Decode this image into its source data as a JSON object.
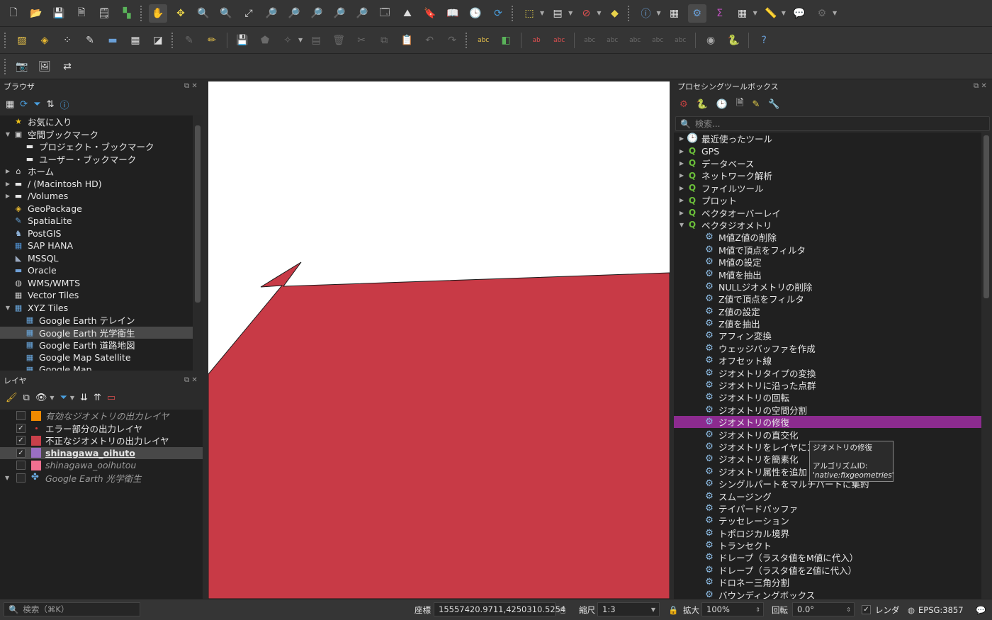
{
  "toolbar1": {
    "icons": [
      "new-project",
      "open-project",
      "save-project",
      "save-as",
      "layout-manager",
      "style-manager",
      "pan",
      "pan-to-selection",
      "zoom-in",
      "zoom-out",
      "zoom-full",
      "zoom-to-selection",
      "zoom-to-layer",
      "zoom-native",
      "zoom-last",
      "zoom-next",
      "new-map-view",
      "new-3d-view",
      "new-bookmark",
      "show-bookmarks",
      "temporal-controller",
      "refresh",
      "select-features",
      "deselect",
      "select-by-location",
      "identify",
      "attribute-table",
      "processing-toolbox",
      "statistics",
      "field-calculator",
      "measure",
      "map-tips",
      "plugins"
    ]
  },
  "toolbar2": {
    "icons": [
      "open-data-source",
      "new-geopackage",
      "digitize",
      "edit-pencil",
      "add-polygon",
      "vertex-tool",
      "undo",
      "redo",
      "label-abc",
      "pin-label",
      "highlight-label",
      "python-console",
      "help"
    ]
  },
  "browser": {
    "title": "ブラウザ",
    "items": [
      {
        "label": "お気に入り",
        "indent": 0,
        "arrow": "",
        "icon": "★",
        "icon_color": "#f0c419"
      },
      {
        "label": "空間ブックマーク",
        "indent": 0,
        "arrow": "▼",
        "icon": "▣",
        "icon_color": "#cfcfcf"
      },
      {
        "label": "プロジェクト・ブックマーク",
        "indent": 1,
        "arrow": "",
        "icon": "▬",
        "icon_color": "#e6e6e6"
      },
      {
        "label": "ユーザー・ブックマーク",
        "indent": 1,
        "arrow": "",
        "icon": "▬",
        "icon_color": "#e6e6e6"
      },
      {
        "label": "ホーム",
        "indent": 0,
        "arrow": "▶",
        "icon": "⌂",
        "icon_color": "#e6e6e6"
      },
      {
        "label": "/ (Macintosh HD)",
        "indent": 0,
        "arrow": "▶",
        "icon": "▬",
        "icon_color": "#e6e6e6"
      },
      {
        "label": "/Volumes",
        "indent": 0,
        "arrow": "▶",
        "icon": "▬",
        "icon_color": "#e6e6e6"
      },
      {
        "label": "GeoPackage",
        "indent": 0,
        "arrow": "",
        "icon": "◈",
        "icon_color": "#e8b830"
      },
      {
        "label": "SpatiaLite",
        "indent": 0,
        "arrow": "",
        "icon": "✎",
        "icon_color": "#6aa9e0"
      },
      {
        "label": "PostGIS",
        "indent": 0,
        "arrow": "",
        "icon": "♞",
        "icon_color": "#8fb3d9"
      },
      {
        "label": "SAP HANA",
        "indent": 0,
        "arrow": "",
        "icon": "▦",
        "icon_color": "#4f8fcf"
      },
      {
        "label": "MSSQL",
        "indent": 0,
        "arrow": "",
        "icon": "◣",
        "icon_color": "#9aa9bf"
      },
      {
        "label": "Oracle",
        "indent": 0,
        "arrow": "",
        "icon": "▬",
        "icon_color": "#6fa0d8"
      },
      {
        "label": "WMS/WMTS",
        "indent": 0,
        "arrow": "",
        "icon": "◍",
        "icon_color": "#d0d0d0"
      },
      {
        "label": "Vector Tiles",
        "indent": 0,
        "arrow": "",
        "icon": "▦",
        "icon_color": "#c8c8c8"
      },
      {
        "label": "XYZ Tiles",
        "indent": 0,
        "arrow": "▼",
        "icon": "▦",
        "icon_color": "#6aa9e0"
      },
      {
        "label": "Google Earth テレイン",
        "indent": 1,
        "arrow": "",
        "icon": "▦",
        "icon_color": "#6aa9e0"
      },
      {
        "label": "Google Earth 光学衛生",
        "indent": 1,
        "arrow": "",
        "icon": "▦",
        "icon_color": "#6aa9e0",
        "selected": true
      },
      {
        "label": "Google Earth 道路地図",
        "indent": 1,
        "arrow": "",
        "icon": "▦",
        "icon_color": "#6aa9e0"
      },
      {
        "label": "Google Map Satellite",
        "indent": 1,
        "arrow": "",
        "icon": "▦",
        "icon_color": "#6aa9e0"
      },
      {
        "label": "Google Map",
        "indent": 1,
        "arrow": "",
        "icon": "▦",
        "icon_color": "#6aa9e0"
      }
    ]
  },
  "layers": {
    "title": "レイヤ",
    "items": [
      {
        "label": "有効なジオメトリの出力レイヤ",
        "checked": false,
        "swatch": "#f08a00",
        "style": "italic",
        "swatch_type": "box"
      },
      {
        "label": "エラー部分の出力レイヤ",
        "checked": true,
        "swatch": "#d33a3a",
        "style": "normal",
        "swatch_type": "dot"
      },
      {
        "label": "不正なジオメトリの出力レイヤ",
        "checked": true,
        "swatch": "#c8404a",
        "style": "normal",
        "swatch_type": "box"
      },
      {
        "label": "shinagawa_oihuto",
        "checked": true,
        "swatch": "#9a6fc2",
        "style": "bold",
        "swatch_type": "box",
        "selected": true
      },
      {
        "label": "shinagawa_ooihutou",
        "checked": false,
        "swatch": "#f07090",
        "style": "italic",
        "swatch_type": "box"
      },
      {
        "label": "Google Earth 光学衛生",
        "checked": false,
        "swatch": "#6aa9e0",
        "style": "italic",
        "swatch_type": "raster"
      }
    ]
  },
  "processing": {
    "title": "プロセシングツールボックス",
    "search_placeholder": "検索...",
    "groups": [
      {
        "label": "最近使ったツール",
        "arrow": "▶",
        "icon": "clock"
      },
      {
        "label": "GPS",
        "arrow": "▶",
        "icon": "q"
      },
      {
        "label": "データベース",
        "arrow": "▶",
        "icon": "q"
      },
      {
        "label": "ネットワーク解析",
        "arrow": "▶",
        "icon": "q"
      },
      {
        "label": "ファイルツール",
        "arrow": "▶",
        "icon": "q"
      },
      {
        "label": "プロット",
        "arrow": "▶",
        "icon": "q"
      },
      {
        "label": "ベクタオーバーレイ",
        "arrow": "▶",
        "icon": "q"
      },
      {
        "label": "ベクタジオメトリ",
        "arrow": "▼",
        "icon": "q"
      }
    ],
    "tools": [
      "M値Z値の削除",
      "M値で頂点をフィルタ",
      "M値の設定",
      "M値を抽出",
      "NULLジオメトリの削除",
      "Z値で頂点をフィルタ",
      "Z値の設定",
      "Z値を抽出",
      "アフィン変換",
      "ウェッジバッファを作成",
      "オフセット線",
      "ジオメトリタイプの変換",
      "ジオメトリに沿った点群",
      "ジオメトリの回転",
      "ジオメトリの空間分割",
      "ジオメトリの修復",
      "ジオメトリの直交化",
      "ジオメトリをレイヤにス",
      "ジオメトリを簡素化",
      "ジオメトリ属性を追加",
      "シングルパートをマルチパートに集約",
      "スムージング",
      "テイパードバッファ",
      "テッセレーション",
      "トポロジカル境界",
      "トランセクト",
      "ドレープ（ラスタ値をM値に代入）",
      "ドレープ（ラスタ値をZ値に代入）",
      "ドロネー三角分割",
      "バウンディングボックス"
    ],
    "selected_tool": "ジオメトリの修復",
    "tooltip": {
      "line1": "ジオメトリの修復",
      "line2": "アルゴリズムID:",
      "line3": "'native:fixgeometries'"
    }
  },
  "status": {
    "search_placeholder": "検索（⌘K）",
    "coord_label": "座標",
    "coord_value": "15557420.9711,4250310.5254",
    "scale_label": "縮尺",
    "scale_value": "1:3",
    "magnifier_label": "拡大",
    "magnifier_value": "100%",
    "rotation_label": "回転",
    "rotation_value": "0.0°",
    "render_label": "レンダ",
    "crs_label": "EPSG:3857"
  },
  "colors": {
    "feature_fill": "#c83a46",
    "selection": "#8c2b8f"
  }
}
